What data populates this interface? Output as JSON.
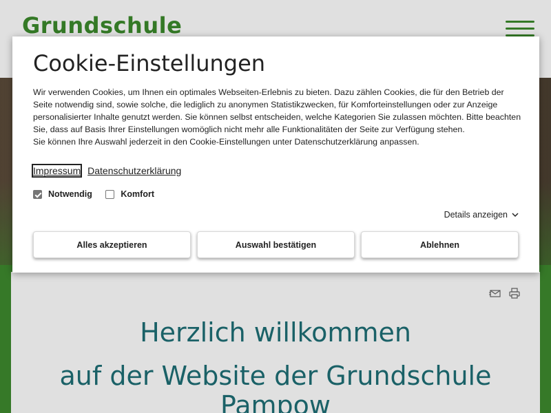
{
  "site": {
    "logo_text": "Grundschule",
    "welcome_line1": "Herzlich willkommen",
    "welcome_line2": "auf der Website der Grundschule",
    "welcome_line3": "Pampow"
  },
  "cookie_dialog": {
    "title": "Cookie-Einstellungen",
    "text_line1": "Wir verwenden Cookies, um Ihnen ein optimales Webseiten-Erlebnis zu bieten. Dazu zählen Cookies, die für den Betrieb der Seite notwendig sind, sowie solche, die lediglich zu anonymen Statistikzwecken, für Komforteinstellungen oder zur Anzeige personalisierter Inhalte genutzt werden. Sie können selbst entscheiden, welche Kategorien Sie zulassen möchten. Bitte beachten Sie, dass auf Basis Ihrer Einstellungen womöglich nicht mehr alle Funktionalitäten der Seite zur Verfügung stehen.",
    "text_line2": "Sie können Ihre Auswahl jederzeit in den Cookie-Einstellungen unter Datenschutzerklärung anpassen.",
    "links": {
      "impressum": "Impressum",
      "datenschutz": "Datenschutzerklärung"
    },
    "checkboxes": [
      {
        "label": "Notwendig",
        "checked": true
      },
      {
        "label": "Komfort",
        "checked": false
      }
    ],
    "details_label": "Details anzeigen",
    "buttons": {
      "accept_all": "Alles akzeptieren",
      "confirm_selection": "Auswahl bestätigen",
      "decline": "Ablehnen"
    }
  },
  "colors": {
    "brand_green": "#3c8a2c",
    "heading_teal": "#1e6f76"
  },
  "icons": [
    "hamburger-menu-icon",
    "mail-icon",
    "print-icon",
    "chevron-down-icon"
  ]
}
